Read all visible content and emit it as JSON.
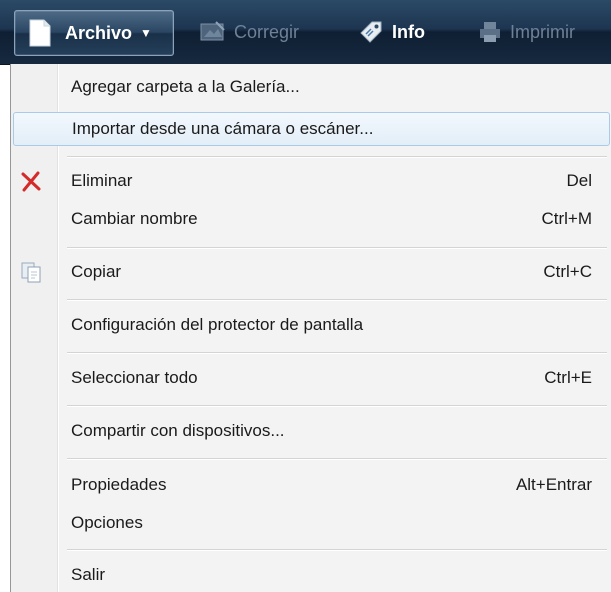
{
  "toolbar": {
    "archivo_label": "Archivo",
    "corregir_label": "Corregir",
    "info_label": "Info",
    "imprimir_label": "Imprimir"
  },
  "menu": {
    "agregar_carpeta": "Agregar carpeta a la Galería...",
    "importar": "Importar desde una cámara o escáner...",
    "eliminar": "Eliminar",
    "eliminar_shortcut": "Del",
    "cambiar_nombre": "Cambiar nombre",
    "cambiar_nombre_shortcut": "Ctrl+M",
    "copiar": "Copiar",
    "copiar_shortcut": "Ctrl+C",
    "protector": "Configuración del protector de pantalla",
    "seleccionar_todo": "Seleccionar todo",
    "seleccionar_todo_shortcut": "Ctrl+E",
    "compartir": "Compartir con dispositivos...",
    "propiedades": "Propiedades",
    "propiedades_shortcut": "Alt+Entrar",
    "opciones": "Opciones",
    "salir": "Salir"
  },
  "colors": {
    "toolbar_bg": "#1d3550",
    "menu_bg": "#f3f3f3",
    "hover_border": "#a9cbe8",
    "delete_icon": "#d42a2a"
  },
  "icons": {
    "archivo": "document-icon",
    "corregir": "fix-photo-icon",
    "info": "info-tag-icon",
    "imprimir": "printer-icon",
    "eliminar": "delete-x-icon",
    "copiar": "copy-icon"
  }
}
